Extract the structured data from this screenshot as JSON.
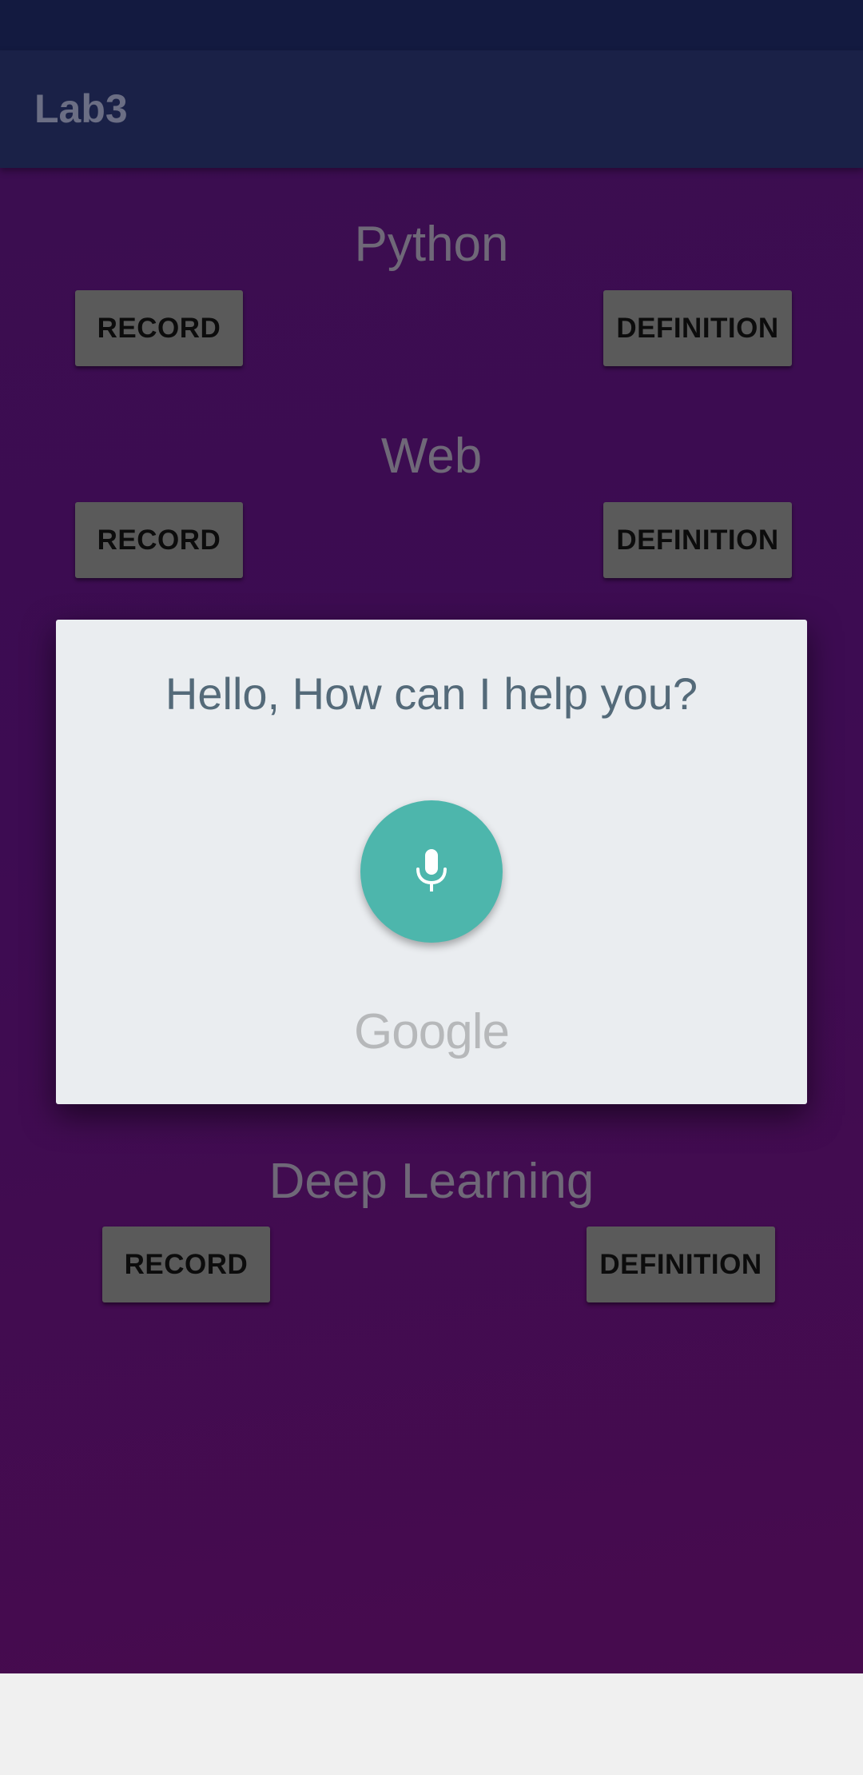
{
  "app": {
    "title": "Lab3"
  },
  "topics": [
    {
      "title": "Python",
      "record_label": "RECORD",
      "definition_label": "DEFINITION"
    },
    {
      "title": "Web",
      "record_label": "RECORD",
      "definition_label": "DEFINITION"
    },
    {
      "title": "Deep Learning",
      "record_label": "RECORD",
      "definition_label": "DEFINITION"
    }
  ],
  "voice_dialog": {
    "prompt": "Hello, How can I help you?",
    "mic_icon": "microphone-icon",
    "brand": "Google"
  },
  "colors": {
    "accent": "#4db6ac",
    "app_bar": "#1a2147",
    "background": "#3d0c52",
    "button": "#5a5a5a"
  }
}
